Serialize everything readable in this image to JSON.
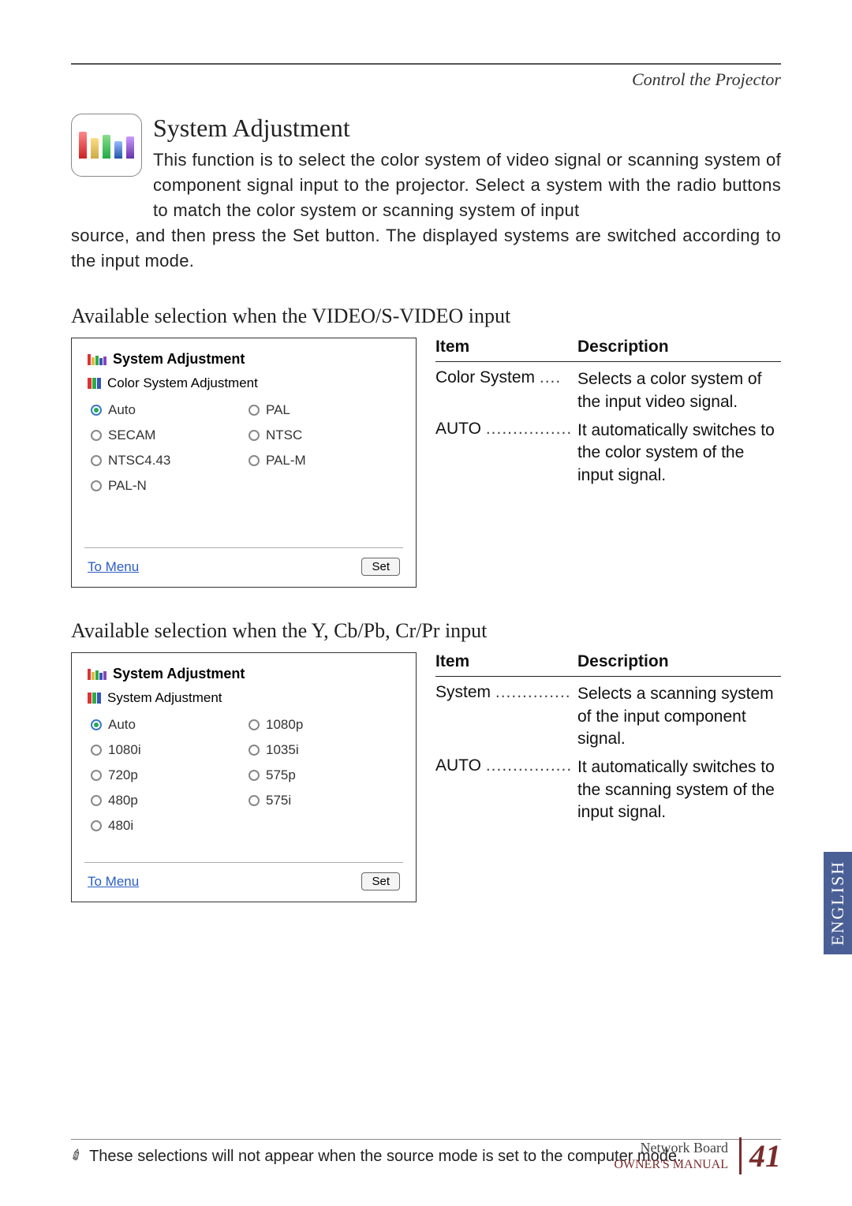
{
  "header": {
    "category": "Control the Projector"
  },
  "section": {
    "title": "System Adjustment",
    "intro_top": "This function is to select the color system of video signal or scanning system of component signal input to the projector. Select a system with the radio buttons to match the color system or scanning system of input",
    "intro_cont": "source, and then press the Set button. The displayed systems are switched according to the input mode."
  },
  "video": {
    "heading": "Available selection when the VIDEO/S-VIDEO input",
    "panel_title": "System Adjustment",
    "panel_subtitle": "Color System Adjustment",
    "options": {
      "auto": "Auto",
      "pal": "PAL",
      "secam": "SECAM",
      "ntsc": "NTSC",
      "ntsc443": "NTSC4.43",
      "palm": "PAL-M",
      "paln": "PAL-N"
    },
    "to_menu": "To Menu",
    "set": "Set",
    "table": {
      "h1": "Item",
      "h2": "Description",
      "row1_item": "Color System",
      "row1_dots": "....",
      "row1_desc": "Selects a color system of the input video signal.",
      "row2_item": "AUTO",
      "row2_dots": "................",
      "row2_desc": "It automatically switches to the color system of the input signal."
    }
  },
  "component": {
    "heading": "Available selection when the Y, Cb/Pb, Cr/Pr input",
    "panel_title": "System Adjustment",
    "panel_subtitle": "System Adjustment",
    "options": {
      "auto": "Auto",
      "p1080p": "1080p",
      "p1080i": "1080i",
      "p1035i": "1035i",
      "p720p": "720p",
      "p575p": "575p",
      "p480p": "480p",
      "p575i": "575i",
      "p480i": "480i"
    },
    "to_menu": "To Menu",
    "set": "Set",
    "table": {
      "h1": "Item",
      "h2": "Description",
      "row1_item": "System",
      "row1_dots": "..............",
      "row1_desc": "Selects a scanning system of the input component signal.",
      "row2_item": "AUTO",
      "row2_dots": "................",
      "row2_desc": "It automatically switches to the scanning system of the input signal."
    }
  },
  "side_tab": "ENGLISH",
  "footnote": "These selections will not appear when the source mode is set to the computer mode.",
  "footer": {
    "line1": "Network Board",
    "line2": "OWNER'S MANUAL",
    "page": "41"
  }
}
